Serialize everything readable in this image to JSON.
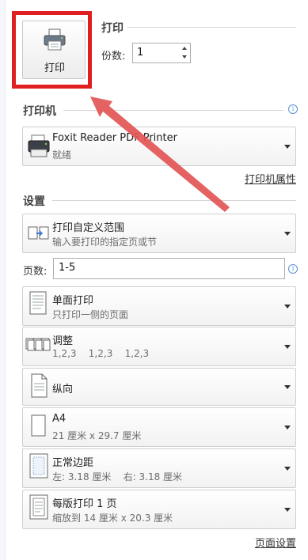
{
  "print": {
    "button_label": "打印",
    "section_title": "打印",
    "copies_label": "份数:",
    "copies_value": "1"
  },
  "printer": {
    "section_title": "打印机",
    "name": "Foxit Reader PDF Printer",
    "status": "就绪",
    "properties_link": "打印机属性"
  },
  "settings": {
    "section_title": "设置",
    "range": {
      "title": "打印自定义范围",
      "subtitle": "输入要打印的指定页或节"
    },
    "pages_label": "页数:",
    "pages_value": "1-5",
    "sides": {
      "title": "单面打印",
      "subtitle": "只打印一侧的页面"
    },
    "collate": {
      "title": "调整",
      "subtitle": "1,2,3    1,2,3    1,2,3"
    },
    "orientation": {
      "title": "纵向"
    },
    "paper": {
      "title": "A4",
      "subtitle": "21 厘米 x 29.7 厘米"
    },
    "margins": {
      "title": "正常边距",
      "subtitle": "左: 3.18 厘米    右: 3.18 厘米"
    },
    "per_sheet": {
      "title": "每版打印 1 页",
      "subtitle": "缩放到 14 厘米 x 20.3 厘米"
    },
    "page_setup_link": "页面设置"
  },
  "colors": {
    "highlight": "#e02020",
    "arrow": "#e05050"
  },
  "icons": [
    "printer-icon",
    "info-icon",
    "page-range-icon",
    "single-side-icon",
    "collate-icon",
    "portrait-icon",
    "paper-size-icon",
    "margins-icon",
    "pages-per-sheet-icon",
    "dropdown-arrow-icon"
  ]
}
